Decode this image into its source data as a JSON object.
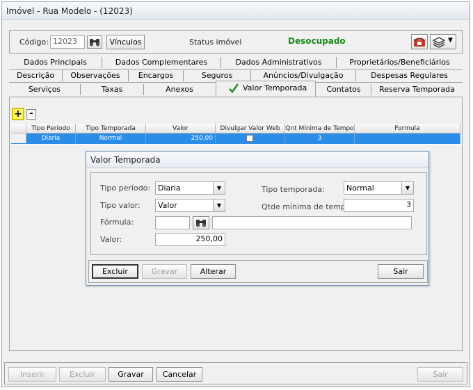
{
  "window": {
    "title": "Imóvel - Rua Modelo - (12023)"
  },
  "header": {
    "codigo_label": "Código:",
    "codigo_value": "12023",
    "vinculos_label": "Vínculos",
    "status_label": "Status imóvel",
    "status_value": "Desocupado",
    "status_color": "#1a8a1a"
  },
  "tabs": {
    "row1": [
      "Dados Principais",
      "Dados Complementares",
      "Dados Administrativos",
      "Proprietários/Beneficiários"
    ],
    "row2": [
      "Descrição",
      "Observações",
      "Encargos",
      "Seguros",
      "Anúncios/Divulgação",
      "Despesas Regulares"
    ],
    "row3": [
      "Serviços",
      "Taxas",
      "Anexos",
      "Valor Temporada",
      "Contatos",
      "Reserva Temporada"
    ],
    "active": "Valor Temporada"
  },
  "grid_toolbar": {
    "add_label": "+",
    "remove_label": "-"
  },
  "grid": {
    "columns": [
      "Tipo Periodo",
      "Tipo Temporada",
      "Valor",
      "Divulgar Valor Web",
      "Qnt Mínima de Tempo",
      "Formula"
    ],
    "rows": [
      {
        "tipo_periodo": "Diaria",
        "tipo_temporada": "Normal",
        "valor": "250,00",
        "divulgar_web": false,
        "qnt_minima": "3",
        "formula": ""
      }
    ]
  },
  "dialog": {
    "title": "Valor Temporada",
    "tipo_periodo_label": "Tipo período:",
    "tipo_periodo_value": "Diaria",
    "tipo_temporada_label": "Tipo temporada:",
    "tipo_temporada_value": "Normal",
    "tipo_valor_label": "Tipo valor:",
    "tipo_valor_value": "Valor",
    "qtde_label": "Qtde mínima de tempo:",
    "qtde_value": "3",
    "formula_label": "Fórmula:",
    "formula_code": "",
    "formula_desc": "",
    "valor_label": "Valor:",
    "valor_value": "250,00",
    "buttons": {
      "excluir": "Excluir",
      "gravar": "Gravar",
      "alterar": "Alterar",
      "sair": "Sair"
    }
  },
  "footer": {
    "inserir": "Inserir",
    "excluir": "Excluir",
    "gravar": "Gravar",
    "cancelar": "Cancelar",
    "sair": "Sair"
  }
}
